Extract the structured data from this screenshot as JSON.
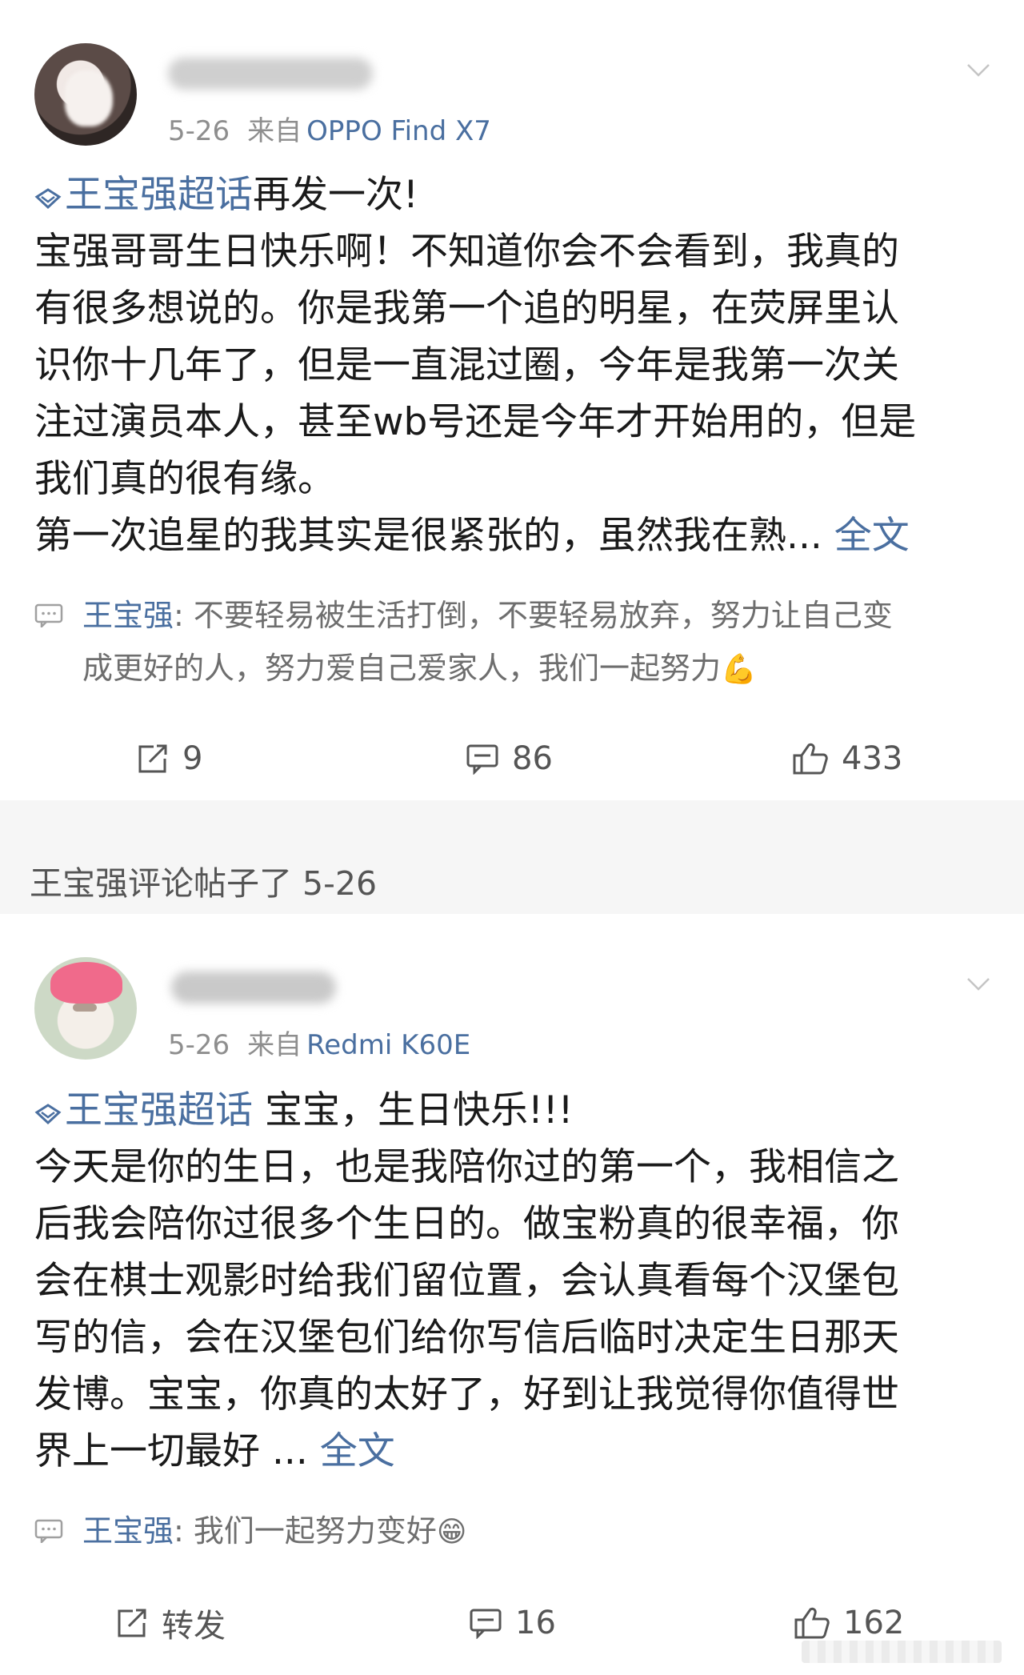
{
  "posts": [
    {
      "date": "5-26",
      "from_label": "来自",
      "device": "OPPO Find X7",
      "topic": "王宝强超话",
      "content_lines": [
        "再发一次!",
        " 宝强哥哥生日快乐啊！不知道你会不会看到，我真的",
        "有很多想说的。你是我第一个追的明星，在荧屏里认",
        "识你十几年了，但是一直混过圈，今年是我第一次关",
        "注过演员本人，甚至wb号还是今年才开始用的，但是",
        "我们真的很有缘。",
        "  第一次追星的我其实是很紧张的，虽然我在熟..."
      ],
      "more_label": "全文",
      "reply": {
        "user": "王宝强",
        "text_line1": ": 不要轻易被生活打倒，不要轻易放弃，努力让自己变",
        "text_line2": "成更好的人，努力爱自己爱家人，我们一起努力",
        "emoji": "💪"
      },
      "actions": {
        "repost": "9",
        "comments": "86",
        "likes": "433"
      }
    },
    {
      "date": "5-26",
      "from_label": "来自",
      "device": "Redmi K60E",
      "topic": "王宝强超话",
      "content_lines": [
        " 宝宝，生日快乐!!!",
        "今天是你的生日，也是我陪你过的第一个，我相信之",
        "后我会陪你过很多个生日的。做宝粉真的很幸福，你",
        "会在棋士观影时给我们留位置，会认真看每个汉堡包",
        "写的信，会在汉堡包们给你写信后临时决定生日那天",
        "发博。宝宝，你真的太好了，好到让我觉得你值得世",
        "界上一切最好 ..."
      ],
      "more_label": "全文",
      "reply": {
        "user": "王宝强",
        "text_line1": ": 我们一起努力变好",
        "emoji": "😁"
      },
      "actions": {
        "repost": "转发",
        "comments": "16",
        "likes": "162"
      }
    }
  ],
  "notice": "王宝强评论帖子了 5-26",
  "colors": {
    "link": "#4a6fa0",
    "meta": "#8e8e8e",
    "text": "#1a1a1a",
    "divider": "#f6f6f6"
  }
}
